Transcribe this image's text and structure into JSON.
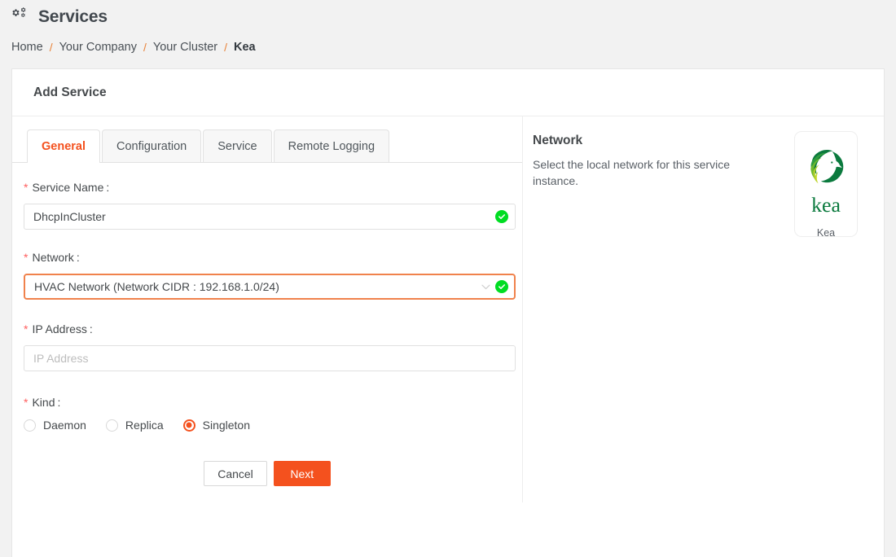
{
  "header": {
    "icon": "cogs-icon",
    "title": "Services"
  },
  "breadcrumb": {
    "items": [
      {
        "label": "Home",
        "current": false
      },
      {
        "label": "Your Company",
        "current": false
      },
      {
        "label": "Your Cluster",
        "current": false
      },
      {
        "label": "Kea",
        "current": true
      }
    ],
    "separator": "/"
  },
  "card": {
    "title": "Add Service"
  },
  "tabs": [
    {
      "label": "General",
      "active": true
    },
    {
      "label": "Configuration",
      "active": false
    },
    {
      "label": "Service",
      "active": false
    },
    {
      "label": "Remote Logging",
      "active": false
    }
  ],
  "form": {
    "service_name": {
      "label": "Service Name",
      "required_marker": "*",
      "colon": ":",
      "value": "DhcpInCluster",
      "placeholder": "Service Name",
      "valid": true,
      "valid_icon": "green-check-icon"
    },
    "network": {
      "label": "Network",
      "required_marker": "*",
      "colon": ":",
      "value": "HVAC Network (Network CIDR : 192.168.1.0/24)",
      "valid": true,
      "valid_icon": "green-check-icon",
      "dropdown_icon": "chevron-down-icon",
      "focused": true
    },
    "ip_address": {
      "label": "IP Address",
      "required_marker": "*",
      "colon": ":",
      "value": "",
      "placeholder": "IP Address"
    },
    "kind": {
      "label": "Kind",
      "required_marker": "*",
      "colon": ":",
      "options": [
        {
          "label": "Daemon",
          "checked": false
        },
        {
          "label": "Replica",
          "checked": false
        },
        {
          "label": "Singleton",
          "checked": true
        }
      ]
    }
  },
  "actions": {
    "cancel_label": "Cancel",
    "next_label": "Next"
  },
  "info": {
    "title": "Network",
    "description": "Select the local network for this service instance.",
    "logo": {
      "wordmark": "kea",
      "caption": "Kea"
    }
  },
  "colors": {
    "accent_orange": "#f4511e",
    "focus_orange": "#f0824c",
    "required_red": "#ff5f5f",
    "valid_green": "#00dd22",
    "kea_dark_green": "#0b7a3e",
    "kea_light_green": "#c4d92e",
    "page_bg": "#f2f2f2",
    "text": "#45494c"
  }
}
